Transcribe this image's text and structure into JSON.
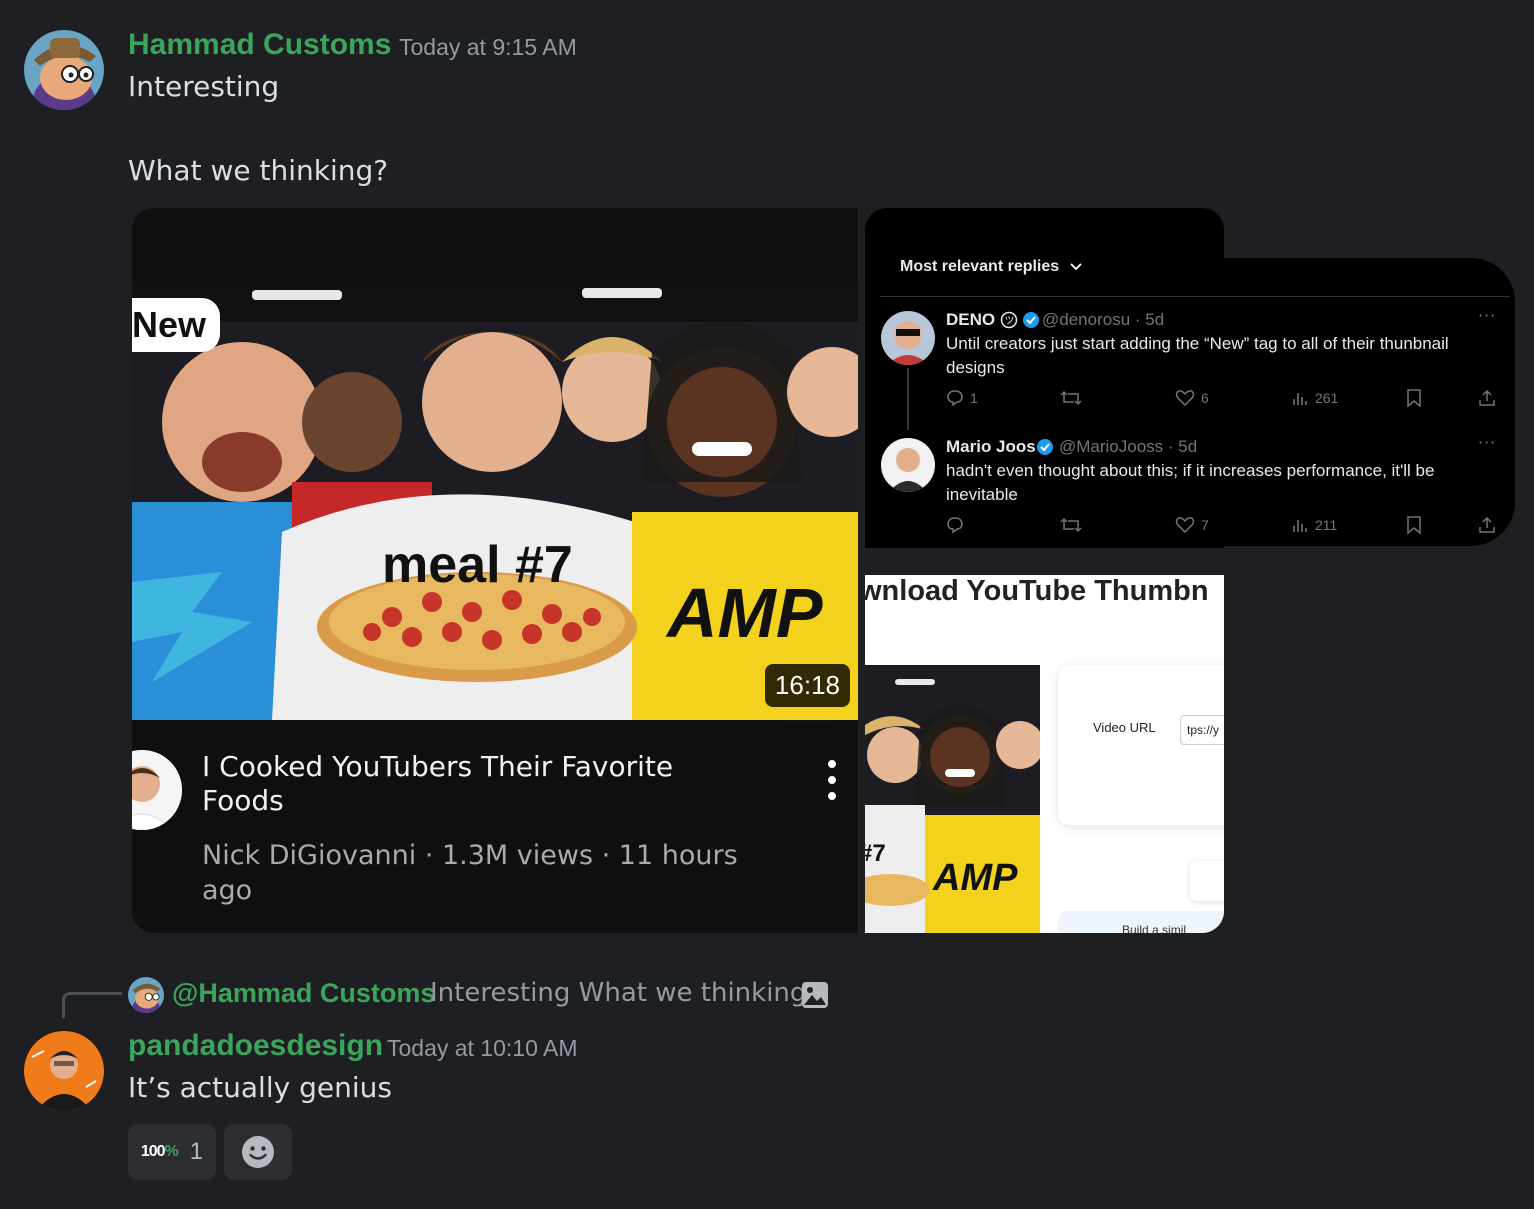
{
  "message1": {
    "username": "Hammad Customs",
    "timestamp": "Today at 9:15 AM",
    "line1": "Interesting",
    "line2": "What we thinking?"
  },
  "youtube": {
    "badge": "New",
    "thumbnail_text": "meal #7",
    "duration": "16:18",
    "title": "I Cooked YouTubers Their Favorite Foods",
    "meta": "Nick DiGiovanni · 1.3M views · 11 hours ago"
  },
  "twitter": {
    "header": "Most relevant replies",
    "replies": [
      {
        "name": "DENO",
        "handle": "@denorosu · 5d",
        "text": "Until creators just start adding the “New” tag to all of their thunbnail designs",
        "replies_count": "1",
        "likes": "6",
        "views": "261"
      },
      {
        "name": "Mario Joos",
        "handle": "@MarioJooss · 5d",
        "text": "hadn't even thought about this; if it increases performance, it'll be inevitable",
        "replies_count": "",
        "likes": "7",
        "views": "211"
      }
    ]
  },
  "download_site": {
    "title": "wnload YouTube Thumbn",
    "label": "Video URL",
    "input_value": "tps://y",
    "footer": "Build a simil"
  },
  "reply_preview": {
    "mention": "@Hammad Customs",
    "text": "Interesting   What we thinking?"
  },
  "message2": {
    "username": "pandadoesdesign",
    "timestamp": "Today at 10:10 AM",
    "text": "It’s actually genius"
  },
  "reactions": [
    {
      "emoji_text": "100",
      "emoji_pct": "%",
      "count": "1"
    }
  ],
  "colors": {
    "background": "#1e1f22",
    "username": "#3ba55c",
    "muted": "#949ba4"
  }
}
